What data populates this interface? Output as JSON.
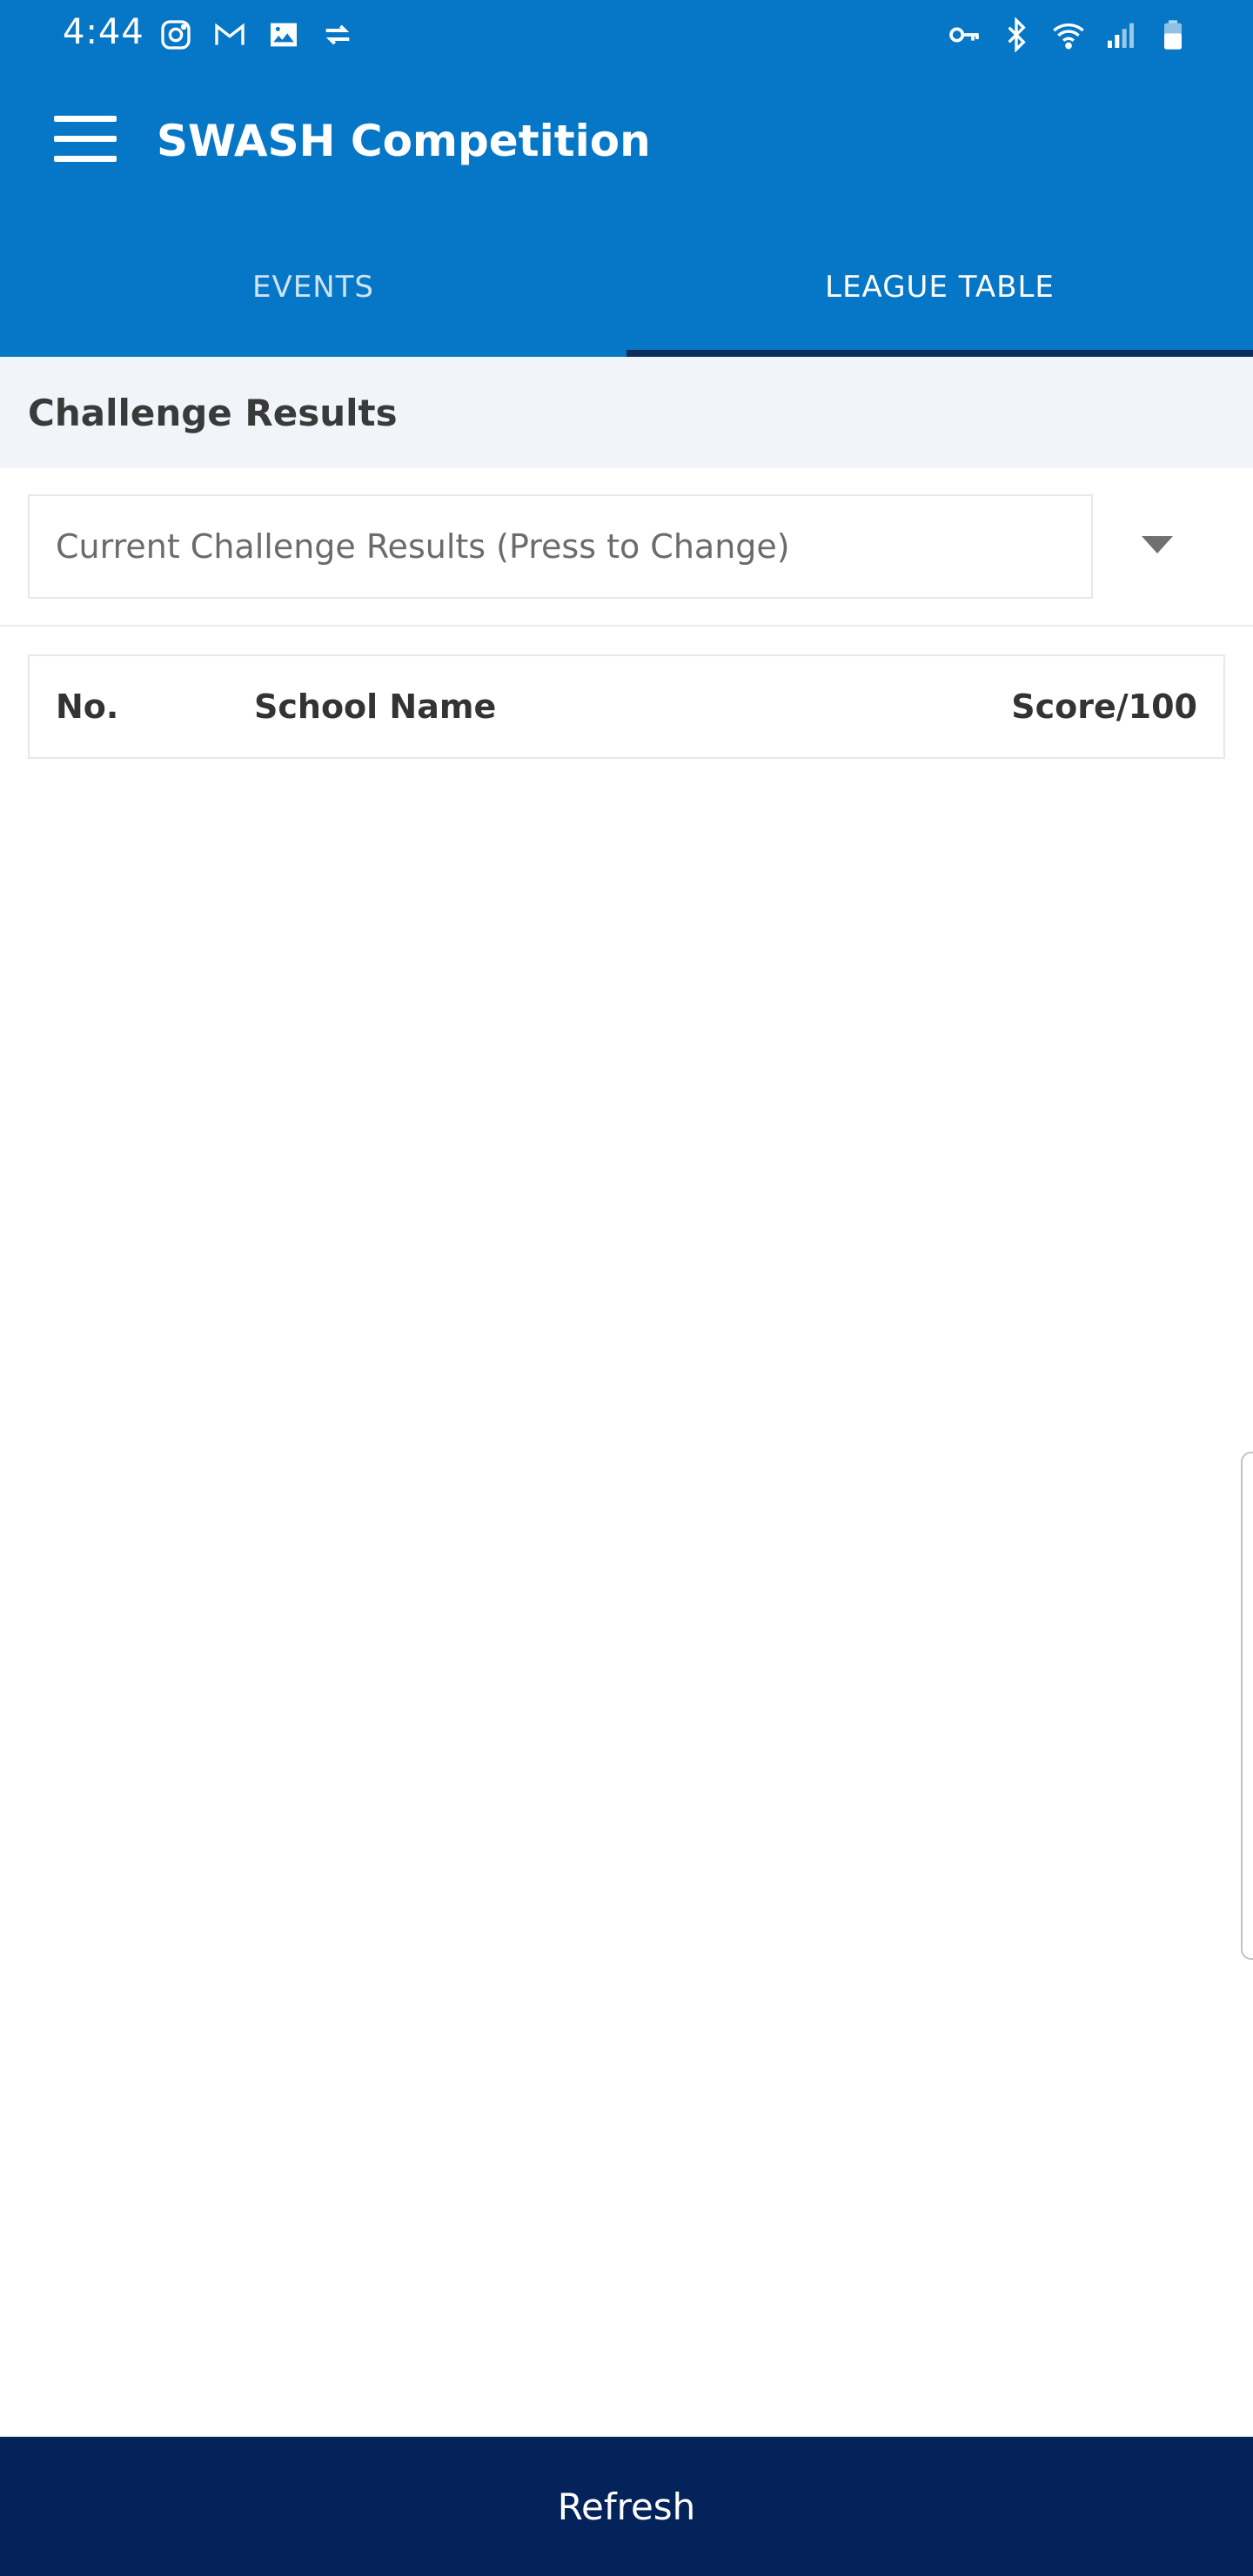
{
  "status_bar": {
    "time": "4:44",
    "left_icons": [
      "instagram-icon",
      "gmail-icon",
      "gallery-icon",
      "sync-icon"
    ],
    "right_icons": [
      "vpn-key-icon",
      "bluetooth-icon",
      "wifi-icon",
      "signal-icon",
      "battery-icon"
    ]
  },
  "app_bar": {
    "title": "SWASH Competition",
    "menu_icon": "hamburger-menu-icon"
  },
  "tabs": [
    {
      "label": "EVENTS",
      "active": false
    },
    {
      "label": "LEAGUE TABLE",
      "active": true
    }
  ],
  "section": {
    "title": "Challenge Results"
  },
  "challenge_select": {
    "value": "Current Challenge Results (Press to Change)",
    "icon": "caret-down-icon"
  },
  "table": {
    "headers": {
      "no": "No.",
      "school_name": "School Name",
      "score": "Score/100"
    },
    "rows": []
  },
  "footer": {
    "refresh_label": "Refresh"
  },
  "colors": {
    "primary": "#0677c6",
    "tab_indicator": "#0d2d5e",
    "footer": "#04235a",
    "section_bg": "#f1f4f8"
  }
}
